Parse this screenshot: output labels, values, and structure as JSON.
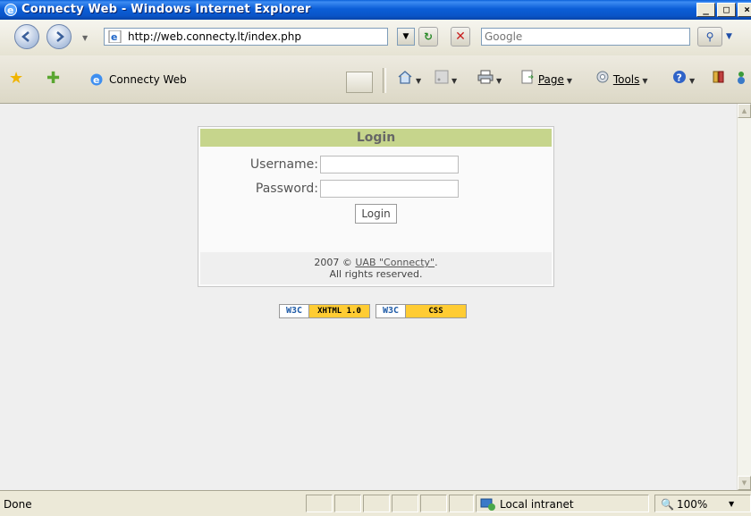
{
  "window": {
    "title": "Connecty Web - Windows Internet Explorer",
    "buttons": {
      "minimize": "_",
      "maximize": "□",
      "close": "×"
    }
  },
  "address_bar": {
    "url": "http://web.connecty.lt/index.php",
    "search_placeholder": "Google"
  },
  "tab": {
    "title": "Connecty Web"
  },
  "commands": {
    "page": "Page",
    "tools": "Tools"
  },
  "login": {
    "heading": "Login",
    "username_label": "Username:",
    "password_label": "Password:",
    "username_value": "",
    "password_value": "",
    "button_label": "Login",
    "footer_prefix": "2007 © ",
    "footer_link": "UAB \"Connecty\"",
    "footer_suffix": ".",
    "footer_line2": "All rights reserved."
  },
  "badges": [
    {
      "w3c": "W3C",
      "label": "XHTML 1.0"
    },
    {
      "w3c": "W3C",
      "label": "CSS"
    }
  ],
  "status": {
    "text": "Done",
    "zone": "Local intranet",
    "zoom": "100%"
  },
  "colors": {
    "login_header": "#c6d58c",
    "titlebar": "#0a5fd8",
    "content_bg": "#efefef",
    "badge_yellow": "#ffcc33"
  }
}
